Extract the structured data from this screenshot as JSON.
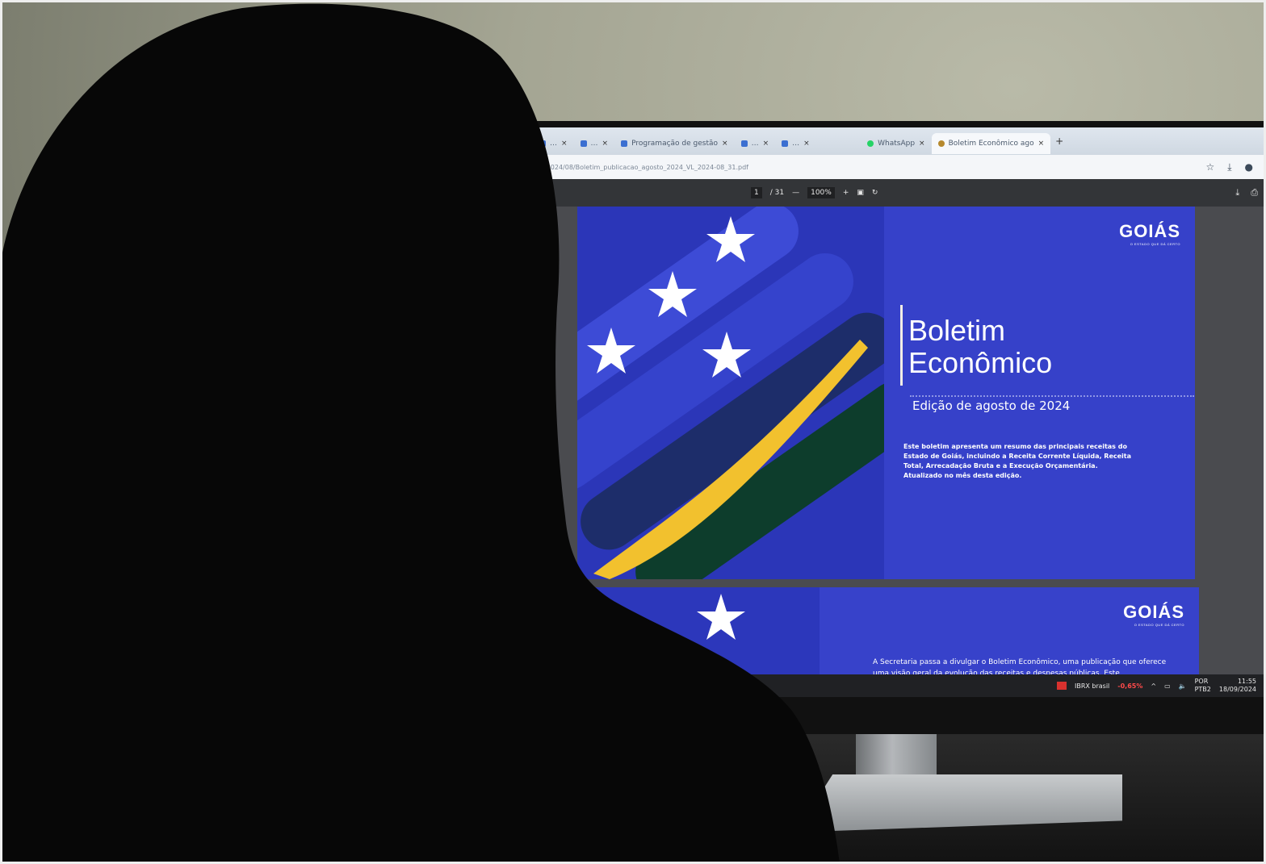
{
  "browser": {
    "tabs": [
      {
        "label": "…",
        "active": false
      },
      {
        "label": "…",
        "active": false
      },
      {
        "label": "Programação de gestão",
        "active": false
      },
      {
        "label": "…",
        "active": false
      },
      {
        "label": "…",
        "active": false
      },
      {
        "label": "WhatsApp",
        "active": false
      },
      {
        "label": "Boletim Econômico ago",
        "active": true
      }
    ],
    "new_tab_label": "+",
    "url": "…/2024/08/Boletim_publicacao_agosto_2024_VL_2024-08_31.pdf",
    "icons": [
      "star-icon",
      "download-icon",
      "profile-icon"
    ]
  },
  "pdf_toolbar": {
    "page_current": "1",
    "page_total": "/ 31",
    "zoom_out": "—",
    "zoom_level": "100%",
    "zoom_in": "+",
    "icons": [
      "fit-page-icon",
      "rotate-icon",
      "download-icon",
      "print-icon"
    ]
  },
  "slide1": {
    "logo": "GOIÁS",
    "logo_tagline": "O ESTADO QUE DÁ CERTO",
    "title_line1": "Boletim",
    "title_line2": "Econômico",
    "edition": "Edição de agosto de 2024",
    "description": "Este boletim apresenta um resumo das principais receitas do Estado de Goiás, incluindo a Receita Corrente Líquida, Receita Total, Arrecadação Bruta e a Execução Orçamentária.",
    "updated": "Atualizado no mês desta edição."
  },
  "slide2": {
    "logo": "GOIÁS",
    "logo_tagline": "O ESTADO QUE DÁ CERTO",
    "text": "A Secretaria passa a divulgar o Boletim Econômico, uma publicação que oferece uma visão geral da evolução das receitas e despesas públicas. Este"
  },
  "taskbar": {
    "ticker_name": "IBRX brasil",
    "ticker_change": "-0,65%",
    "lang": "POR",
    "layout": "PTB2",
    "time": "11:55",
    "date": "18/09/2024"
  },
  "colors": {
    "slide_blue": "#3641c9",
    "flag_yellow": "#f2c12e",
    "flag_green": "#0d3d2c",
    "negative": "#ff4a4a"
  }
}
